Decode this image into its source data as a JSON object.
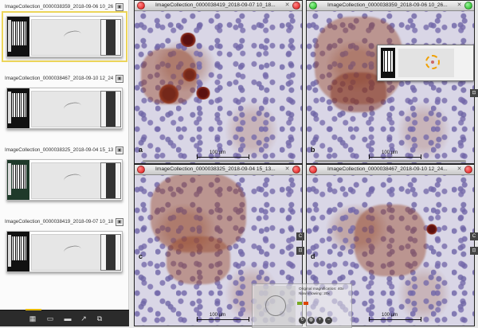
{
  "colors": {
    "selected_outline": "#ecd55a",
    "close_red": "#e01010",
    "sync_green": "#12b812",
    "toolbar": "#2b2b2b"
  },
  "sidebar": {
    "slides": [
      {
        "title": "ImageCollection_0000038359_2018-09-06 10_26_...",
        "selected": true
      },
      {
        "title": "ImageCollection_0000038467_2018-09-10 12_24...",
        "selected": false
      },
      {
        "title": "ImageCollection_0000038325_2018-09-04 15_13...",
        "selected": false
      },
      {
        "title": "ImageCollection_0000038419_2018-09-07 10_18...",
        "selected": false
      }
    ],
    "toolbar_icons": [
      "grid-view-icon",
      "folder-icon",
      "monitor-icon",
      "pointer-icon",
      "copy-icon"
    ]
  },
  "panes": [
    {
      "id": "a",
      "title": "ImageCollection_0000038419_2018-09-07 10_18...",
      "label": "a",
      "scale": "100 µm",
      "left_dot": "red",
      "right_dot": "red"
    },
    {
      "id": "b",
      "title": "ImageCollection_0000038359_2018-09-06 10_26...",
      "label": "b",
      "scale": "100 µm",
      "left_dot": "green",
      "right_dot": "green"
    },
    {
      "id": "c",
      "title": "ImageCollection_0000038325_2018-09-04 15_13...",
      "label": "c",
      "scale": "100 µm",
      "left_dot": "red",
      "right_dot": "red"
    },
    {
      "id": "d",
      "title": "ImageCollection_0000038467_2018-09-10 12_24...",
      "label": "d",
      "scale": "100 µm",
      "left_dot": "red",
      "right_dot": "red"
    }
  ],
  "navigator": {
    "info_line1": "Original magnification: 40x",
    "info_line2": "Now showing: 20x",
    "icons": [
      "rotate-icon",
      "globe-icon",
      "zoom-in-icon",
      "zoom-out-icon"
    ]
  }
}
